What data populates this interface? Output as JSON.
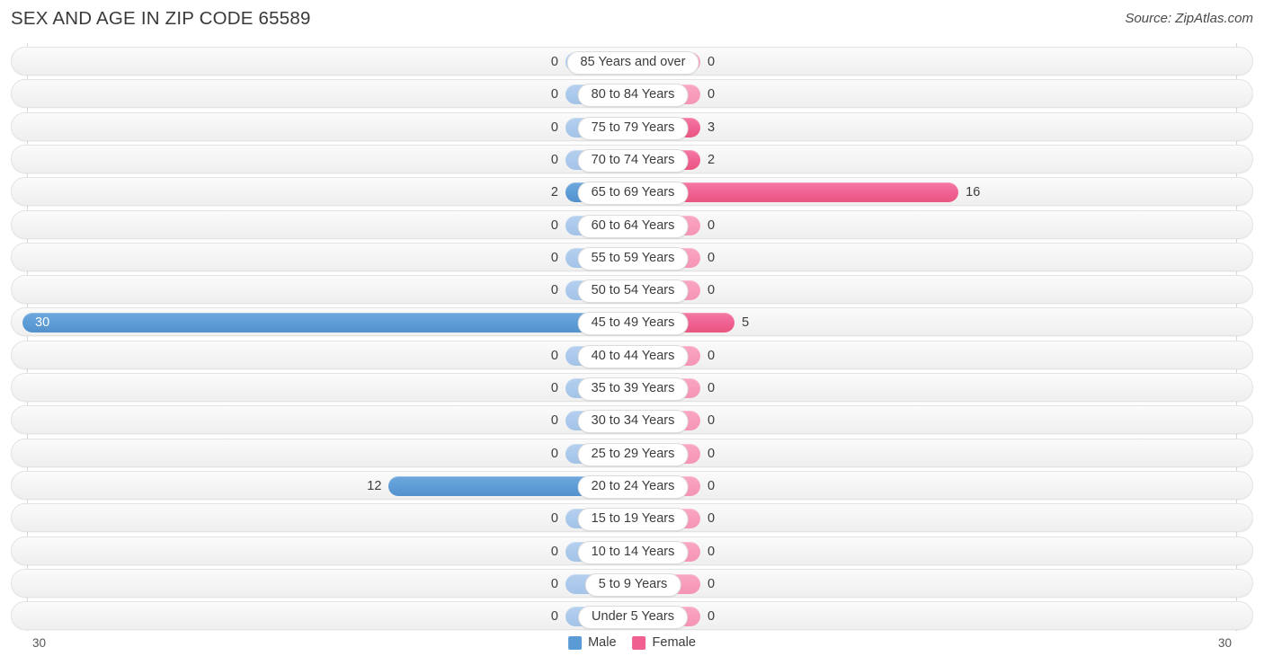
{
  "header": {
    "title": "SEX AND AGE IN ZIP CODE 65589",
    "source": "Source: ZipAtlas.com"
  },
  "legend": {
    "male": {
      "label": "Male",
      "color": "#5b9bd5"
    },
    "female": {
      "label": "Female",
      "color": "#ef5f90"
    }
  },
  "axis": {
    "left_tick": "30",
    "right_tick": "30",
    "max": 30
  },
  "chart_data": {
    "type": "bar",
    "orientation": "horizontal",
    "style": "diverging-population-pyramid",
    "title": "SEX AND AGE IN ZIP CODE 65589",
    "xlabel": "",
    "ylabel": "",
    "xlim": [
      30,
      30
    ],
    "grid": false,
    "legend_position": "bottom-center",
    "categories": [
      "85 Years and over",
      "80 to 84 Years",
      "75 to 79 Years",
      "70 to 74 Years",
      "65 to 69 Years",
      "60 to 64 Years",
      "55 to 59 Years",
      "50 to 54 Years",
      "45 to 49 Years",
      "40 to 44 Years",
      "35 to 39 Years",
      "30 to 34 Years",
      "25 to 29 Years",
      "20 to 24 Years",
      "15 to 19 Years",
      "10 to 14 Years",
      "5 to 9 Years",
      "Under 5 Years"
    ],
    "series": [
      {
        "name": "Male",
        "color": "#5b9bd5",
        "values": [
          0,
          0,
          0,
          0,
          2,
          0,
          0,
          0,
          30,
          0,
          0,
          0,
          0,
          12,
          0,
          0,
          0,
          0
        ]
      },
      {
        "name": "Female",
        "color": "#ef5f90",
        "values": [
          0,
          0,
          3,
          2,
          16,
          0,
          0,
          0,
          5,
          0,
          0,
          0,
          0,
          0,
          0,
          0,
          0,
          0
        ]
      }
    ]
  }
}
